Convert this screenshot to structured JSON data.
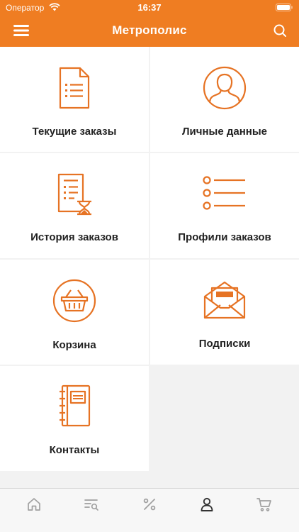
{
  "status": {
    "carrier": "Оператор",
    "time": "16:37"
  },
  "navbar": {
    "title": "Метрополис"
  },
  "tiles": [
    {
      "label": "Текущие заказы",
      "icon": "document-list-icon"
    },
    {
      "label": "Личные данные",
      "icon": "user-avatar-icon"
    },
    {
      "label": "История заказов",
      "icon": "history-document-icon"
    },
    {
      "label": "Профили заказов",
      "icon": "bullet-list-icon"
    },
    {
      "label": "Корзина",
      "icon": "basket-icon"
    },
    {
      "label": "Подписки",
      "icon": "envelope-icon"
    },
    {
      "label": "Контакты",
      "icon": "address-book-icon"
    }
  ],
  "tabbar": {
    "active_index": 3,
    "items": [
      "home-icon",
      "catalog-search-icon",
      "percent-icon",
      "profile-icon",
      "cart-icon"
    ]
  },
  "colors": {
    "accent": "#ef7d22",
    "icon": "#e67324",
    "tab_inactive": "#a0a0a0",
    "tab_active": "#333333"
  }
}
